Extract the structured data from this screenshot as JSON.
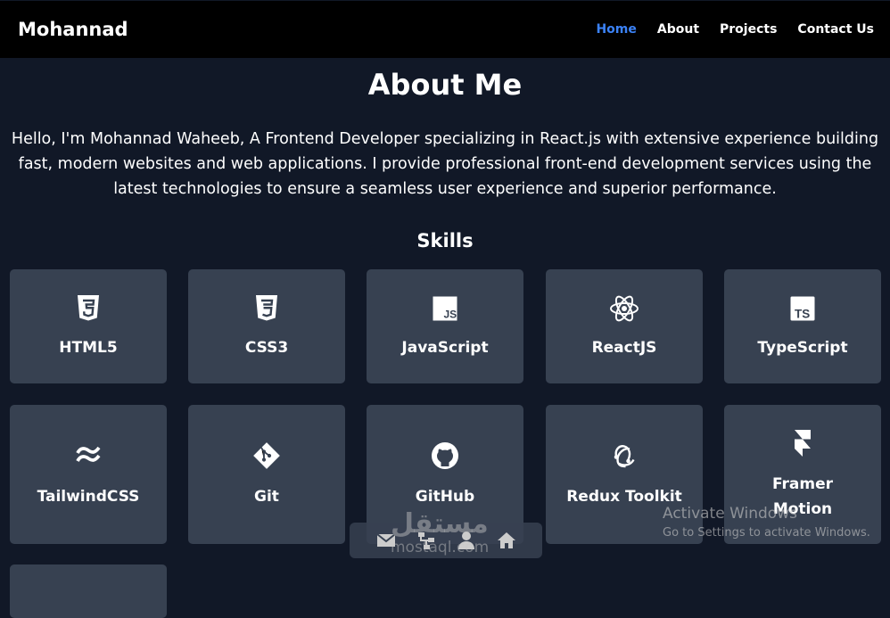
{
  "nav": {
    "logo": "Mohannad",
    "links": [
      "Home",
      "About",
      "Projects",
      "Contact Us"
    ],
    "active": "Home"
  },
  "about": {
    "title": "About Me",
    "intro": "Hello, I'm Mohannad Waheeb, A Frontend Developer specializing in React.js with extensive experience building fast, modern websites and web applications. I provide professional front-end development services using the latest technologies to ensure a seamless user experience and superior performance."
  },
  "skills": {
    "title": "Skills",
    "items": [
      {
        "label": "HTML5",
        "icon": "html5-icon"
      },
      {
        "label": "CSS3",
        "icon": "css3-icon"
      },
      {
        "label": "JavaScript",
        "icon": "javascript-icon"
      },
      {
        "label": "ReactJS",
        "icon": "react-icon"
      },
      {
        "label": "TypeScript",
        "icon": "typescript-icon"
      },
      {
        "label": "TailwindCSS",
        "icon": "tailwind-icon"
      },
      {
        "label": "Git",
        "icon": "git-icon"
      },
      {
        "label": "GitHub",
        "icon": "github-icon"
      },
      {
        "label": "Redux Toolkit",
        "icon": "redux-icon"
      },
      {
        "label": "Framer Motion",
        "icon": "framer-icon"
      }
    ]
  },
  "watermark": {
    "brand": "mostaql.com",
    "windows_title": "Activate Windows",
    "windows_sub": "Go to Settings to activate Windows."
  },
  "colors": {
    "bg": "#111827",
    "card": "#374151",
    "accent": "#3b82f6",
    "nav": "#000000"
  }
}
